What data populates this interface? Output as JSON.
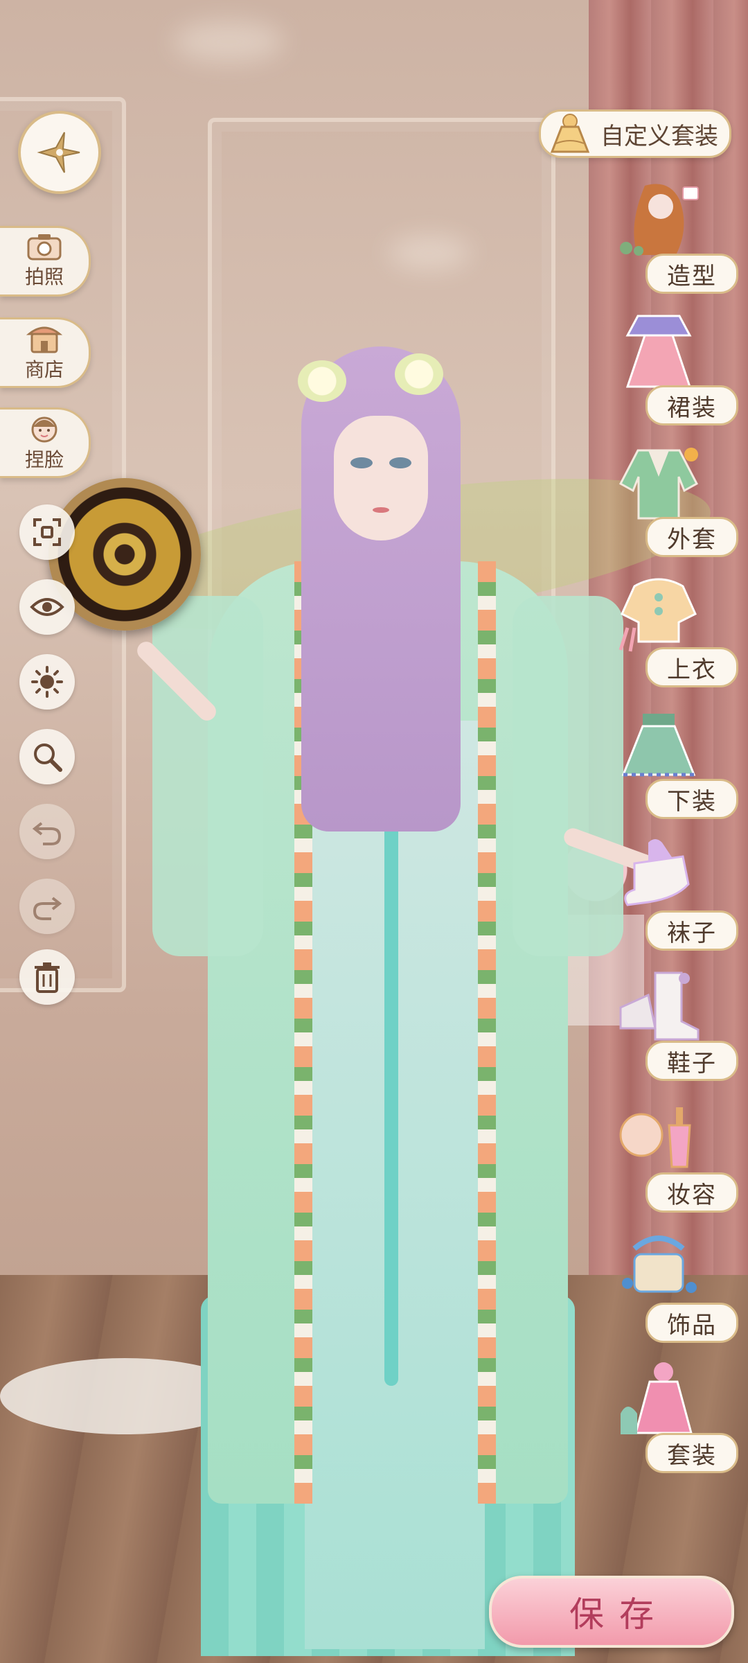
{
  "left_menu": {
    "photo_label": "拍照",
    "shop_label": "商店",
    "face_label": "捏脸"
  },
  "tools": [
    "fullscreen-icon",
    "eye-icon",
    "brightness-icon",
    "zoom-icon",
    "undo-icon",
    "redo-icon",
    "trash-icon"
  ],
  "custom_outfit_label": "自定义套装",
  "categories": [
    {
      "label": "造型"
    },
    {
      "label": "裙装"
    },
    {
      "label": "外套"
    },
    {
      "label": "上衣"
    },
    {
      "label": "下装"
    },
    {
      "label": "袜子"
    },
    {
      "label": "鞋子"
    },
    {
      "label": "妆容"
    },
    {
      "label": "饰品"
    },
    {
      "label": "套装"
    }
  ],
  "save_label": "保存",
  "colors": {
    "accent_gold": "#d9bb88",
    "panel_bg": "#fcf7ef",
    "save_pink": "#f29aab",
    "save_text": "#b23d5c"
  }
}
